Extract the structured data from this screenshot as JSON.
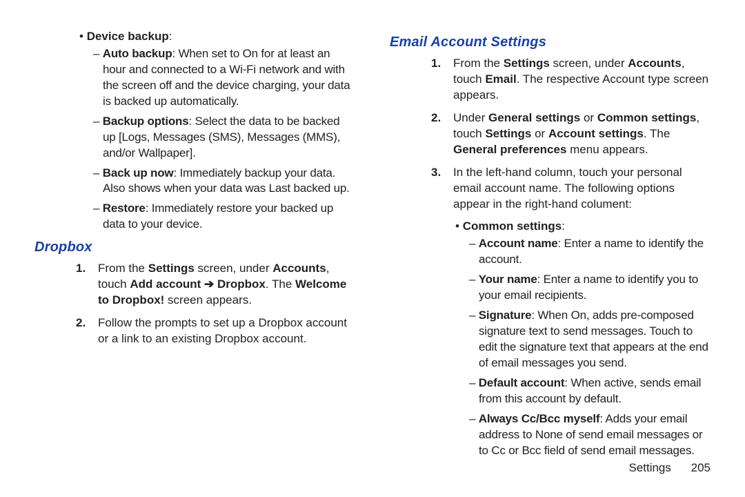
{
  "left": {
    "deviceBackup": {
      "header": "Device backup",
      "items": [
        {
          "lead": "Auto backup",
          "rest": ": When set to On for at least an hour and connected to a Wi-Fi network and with the screen off and the device charging, your data is backed up automatically."
        },
        {
          "lead": "Backup options",
          "rest": ": Select the data to be backed up [Logs, Messages (SMS), Messages (MMS), and/or Wallpaper]."
        },
        {
          "lead": "Back up now",
          "rest": ": Immediately backup your data. Also shows when your data was Last backed up."
        },
        {
          "lead": "Restore",
          "rest": ": Immediately restore your backed up data to your device."
        }
      ]
    },
    "dropbox": {
      "title": "Dropbox",
      "steps": [
        {
          "num": "1.",
          "parts": [
            {
              "t": "From the ",
              "b": false
            },
            {
              "t": "Settings",
              "b": true
            },
            {
              "t": " screen, under ",
              "b": false
            },
            {
              "t": "Accounts",
              "b": true
            },
            {
              "t": ", touch ",
              "b": false
            },
            {
              "t": "Add account ",
              "b": true
            },
            {
              "t": "➔",
              "b": true,
              "arrow": true
            },
            {
              "t": " Dropbox",
              "b": true
            },
            {
              "t": ". The ",
              "b": false
            },
            {
              "t": "Welcome to Dropbox!",
              "b": true
            },
            {
              "t": " screen appears.",
              "b": false
            }
          ]
        },
        {
          "num": "2.",
          "parts": [
            {
              "t": "Follow the prompts to set up a Dropbox account or a link to an existing Dropbox account.",
              "b": false
            }
          ]
        }
      ]
    }
  },
  "right": {
    "email": {
      "title": "Email Account Settings",
      "steps": [
        {
          "num": "1.",
          "parts": [
            {
              "t": "From the ",
              "b": false
            },
            {
              "t": "Settings",
              "b": true
            },
            {
              "t": " screen, under ",
              "b": false
            },
            {
              "t": "Accounts",
              "b": true
            },
            {
              "t": ", touch ",
              "b": false
            },
            {
              "t": "Email",
              "b": true
            },
            {
              "t": ". The respective Account type screen appears.",
              "b": false
            }
          ]
        },
        {
          "num": "2.",
          "parts": [
            {
              "t": "Under ",
              "b": false
            },
            {
              "t": "General settings",
              "b": true
            },
            {
              "t": " or ",
              "b": false
            },
            {
              "t": "Common settings",
              "b": true
            },
            {
              "t": ", touch ",
              "b": false
            },
            {
              "t": "Settings",
              "b": true
            },
            {
              "t": " or ",
              "b": false
            },
            {
              "t": "Account settings",
              "b": true
            },
            {
              "t": ". The ",
              "b": false
            },
            {
              "t": "General preferences",
              "b": true
            },
            {
              "t": " menu appears.",
              "b": false
            }
          ]
        },
        {
          "num": "3.",
          "parts": [
            {
              "t": "In the left-hand column, touch your personal email account name. The following options appear in the right-hand colument:",
              "b": false
            }
          ]
        }
      ],
      "common": {
        "header": "Common settings",
        "items": [
          {
            "lead": "Account name",
            "rest": ": Enter a name to identify the account."
          },
          {
            "lead": "Your name",
            "rest": ": Enter a name to identify you to your email recipients."
          },
          {
            "lead": "Signature",
            "rest": ": When On, adds pre-composed signature text to send messages. Touch to edit the signature text that appears at the end of email messages you send."
          },
          {
            "lead": "Default account",
            "rest": ": When active, sends email from this account by default."
          },
          {
            "lead": "Always Cc/Bcc myself",
            "rest": ": Adds your email address to None of send email messages or to Cc or Bcc field of send email messages."
          }
        ]
      }
    }
  },
  "footer": {
    "section": "Settings",
    "page": "205"
  }
}
